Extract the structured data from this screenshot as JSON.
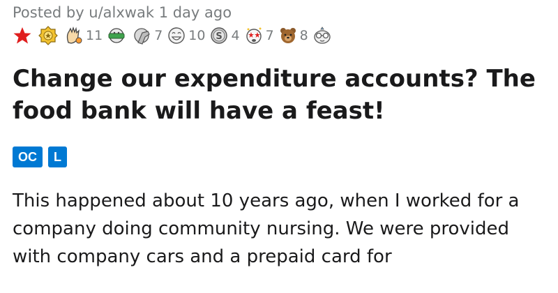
{
  "post": {
    "posted_by": "Posted by u/alxwak 1 day ago",
    "awards": [
      {
        "name": "red-star-award-icon",
        "count": ""
      },
      {
        "name": "gold-seal-award-icon",
        "count": ""
      },
      {
        "name": "wholesome-hand-award-icon",
        "count": "11"
      },
      {
        "name": "money-hug-award-icon",
        "count": ""
      },
      {
        "name": "facepalm-award-icon",
        "count": "7"
      },
      {
        "name": "laughing-face-award-icon",
        "count": "10"
      },
      {
        "name": "silver-coin-award-icon",
        "count": "4"
      },
      {
        "name": "starstruck-face-award-icon",
        "count": "7"
      },
      {
        "name": "bear-award-icon",
        "count": "8"
      },
      {
        "name": "glasses-face-award-icon",
        "count": ""
      }
    ],
    "title": "Change our expenditure accounts? The food bank will have a feast!",
    "flairs": [
      "OC",
      "L"
    ],
    "body": "This happened about 10 years ago, when I worked for a company doing community nursing. We were provided with company cars and a prepaid card for"
  },
  "colors": {
    "flair": "#0079d3",
    "meta": "#787c7e",
    "text": "#1a1a1b"
  }
}
